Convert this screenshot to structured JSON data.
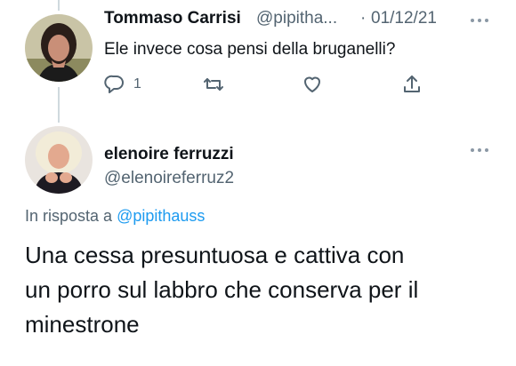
{
  "parent_tweet": {
    "display_name": "Tommaso Carrisi",
    "handle": "@pipitha...",
    "separator": "·",
    "date": "01/12/21",
    "text": "Ele invece cosa pensi della bruganelli?",
    "actions": {
      "reply_icon": "reply-icon",
      "reply_count": "1",
      "retweet_icon": "retweet-icon",
      "like_icon": "heart-icon",
      "share_icon": "share-icon"
    }
  },
  "reply_tweet": {
    "display_name": "elenoire ferruzzi",
    "handle": "@elenoireferruz2",
    "reply_to_prefix": "In risposta a",
    "reply_to_handle": "@pipithauss",
    "text_lines": [
      "Una cessa presuntuosa e cattiva con",
      "un porro sul labbro che conserva per il",
      "minestrone"
    ]
  },
  "colors": {
    "text": "#0f1419",
    "muted": "#536471",
    "link": "#1d9bf0",
    "thread_line": "#cfd9de"
  }
}
